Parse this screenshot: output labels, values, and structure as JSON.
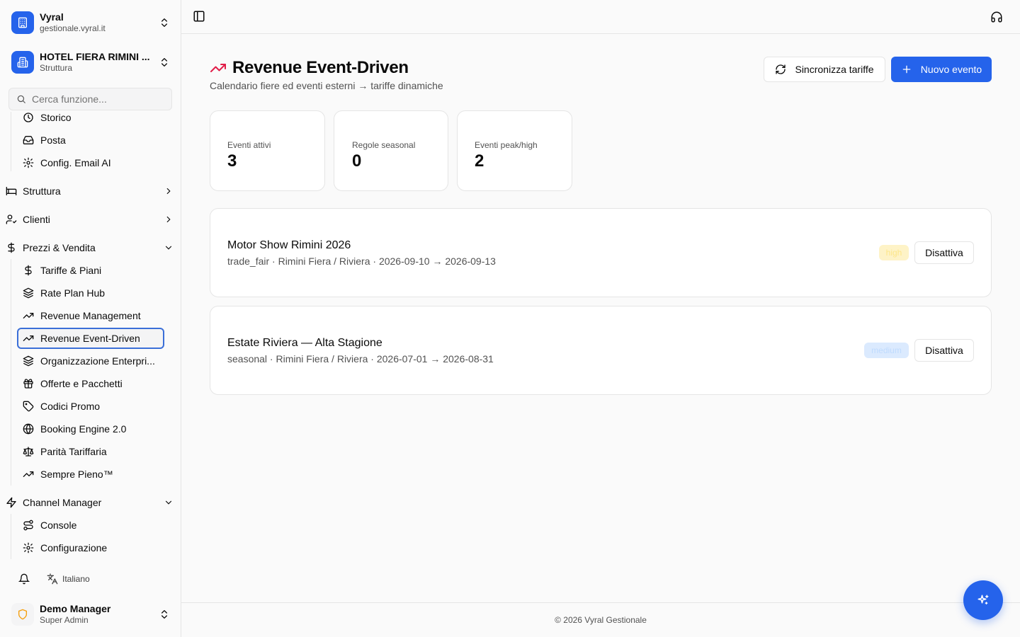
{
  "colors": {
    "accent": "#2563eb",
    "title_icon": "#e11d48",
    "badge_high_bg": "#fef3c7",
    "badge_high_fg": "#fde68a",
    "badge_medium_bg": "#dbeafe",
    "badge_medium_fg": "#bfdbfe"
  },
  "org": {
    "name": "Vyral",
    "domain": "gestionale.vyral.it"
  },
  "property": {
    "name": "HOTEL FIERA RIMINI ...",
    "type": "Struttura"
  },
  "search": {
    "placeholder": "Cerca funzione..."
  },
  "nav": {
    "pre_items": [
      {
        "label": "Storico",
        "icon": "history-icon"
      },
      {
        "label": "Posta",
        "icon": "mail-icon"
      },
      {
        "label": "Config. Email AI",
        "icon": "gear-icon"
      }
    ],
    "groups": {
      "struttura": "Struttura",
      "clienti": "Clienti",
      "prezzi": "Prezzi & Vendita",
      "channel": "Channel Manager"
    },
    "prezzi_items": [
      {
        "label": "Tariffe & Piani",
        "icon": "dollar-icon"
      },
      {
        "label": "Rate Plan Hub",
        "icon": "layers-icon"
      },
      {
        "label": "Revenue Management",
        "icon": "trending-up-icon"
      },
      {
        "label": "Revenue Event-Driven",
        "icon": "trending-up-icon",
        "active": true
      },
      {
        "label": "Organizzazione Enterpri...",
        "icon": "layers-icon"
      },
      {
        "label": "Offerte e Pacchetti",
        "icon": "gift-icon"
      },
      {
        "label": "Codici Promo",
        "icon": "tag-icon"
      },
      {
        "label": "Booking Engine 2.0",
        "icon": "globe-icon"
      },
      {
        "label": "Parità Tariffaria",
        "icon": "scale-icon"
      },
      {
        "label": "Sempre Pieno™",
        "icon": "trending-up-icon"
      }
    ],
    "channel_items": [
      {
        "label": "Console",
        "icon": "route-icon"
      },
      {
        "label": "Configurazione",
        "icon": "gear-icon"
      }
    ]
  },
  "language": "Italiano",
  "user": {
    "name": "Demo Manager",
    "role": "Super Admin"
  },
  "page": {
    "title": "Revenue Event-Driven",
    "subtitle": "Calendario fiere ed eventi esterni → tariffe dinamiche",
    "sync_label": "Sincronizza tariffe",
    "new_label": "Nuovo evento"
  },
  "stats": [
    {
      "label": "Eventi attivi",
      "value": "3"
    },
    {
      "label": "Regole seasonal",
      "value": "0"
    },
    {
      "label": "Eventi peak/high",
      "value": "2"
    }
  ],
  "events": [
    {
      "name": "Motor Show Rimini 2026",
      "meta": "trade_fair · Rimini Fiera / Riviera · 2026-09-10 → 2026-09-13",
      "badge": "high",
      "action": "Disattiva"
    },
    {
      "name": "Estate Riviera — Alta Stagione",
      "meta": "seasonal · Rimini Fiera / Riviera · 2026-07-01 → 2026-08-31",
      "badge": "medium",
      "action": "Disattiva"
    }
  ],
  "footer": "© 2026 Vyral Gestionale"
}
